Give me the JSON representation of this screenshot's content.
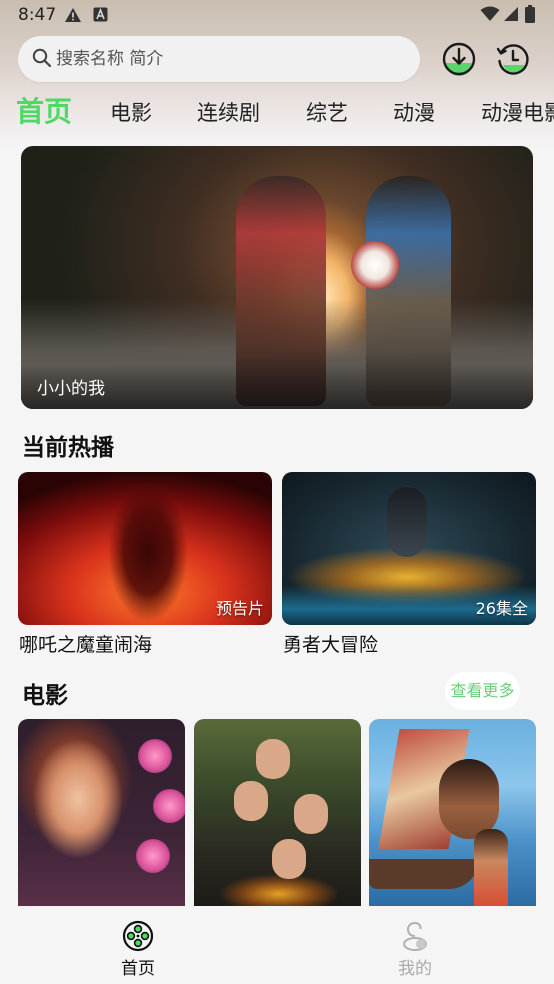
{
  "status_bar": {
    "time": "8:47"
  },
  "search": {
    "placeholder": "搜索名称 简介"
  },
  "tabs": [
    {
      "label": "首页",
      "active": true
    },
    {
      "label": "电影",
      "active": false
    },
    {
      "label": "连续剧",
      "active": false
    },
    {
      "label": "综艺",
      "active": false
    },
    {
      "label": "动漫",
      "active": false
    },
    {
      "label": "动漫电影",
      "active": false
    }
  ],
  "banner": {
    "title": "小小的我"
  },
  "hot_section": {
    "title": "当前热播",
    "items": [
      {
        "name": "哪吒之魔童闹海",
        "badge": "预告片"
      },
      {
        "name": "勇者大冒险",
        "badge": "26集全"
      }
    ]
  },
  "movie_section": {
    "title": "电影",
    "see_more": "查看更多"
  },
  "bottom_nav": {
    "items": [
      {
        "label": "首页",
        "active": true
      },
      {
        "label": "我的",
        "active": false
      }
    ]
  },
  "colors": {
    "accent": "#4cd964",
    "see_more_text": "#6ad07a",
    "inactive_nav": "#a9a9a9"
  }
}
